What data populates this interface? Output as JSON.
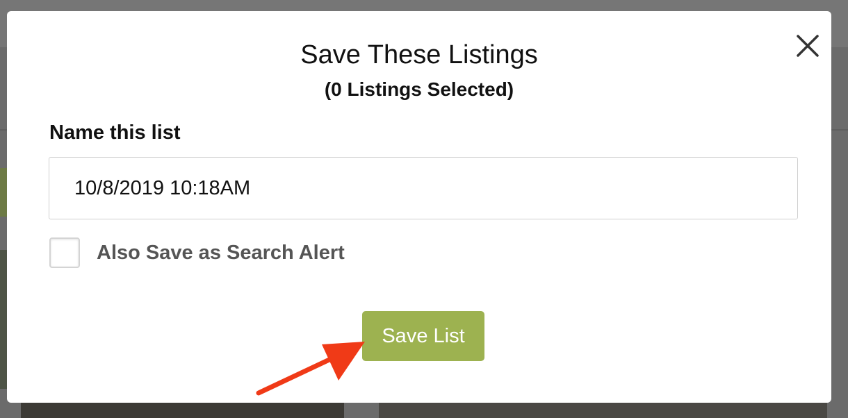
{
  "modal": {
    "title": "Save These Listings",
    "subtitle": "(0 Listings Selected)",
    "close_icon": "close-x-icon",
    "name_label": "Name this list",
    "name_value": "10/8/2019 10:18AM",
    "alert_checkbox": {
      "label": "Also Save as Search Alert",
      "checked": false
    },
    "save_button_label": "Save List"
  },
  "colors": {
    "save_button": "#9db250",
    "annotation_arrow": "#f03a17",
    "overlay": "#6b6b6b"
  },
  "annotation": {
    "icon": "red-arrow-icon",
    "points_to": "save-list-button"
  }
}
